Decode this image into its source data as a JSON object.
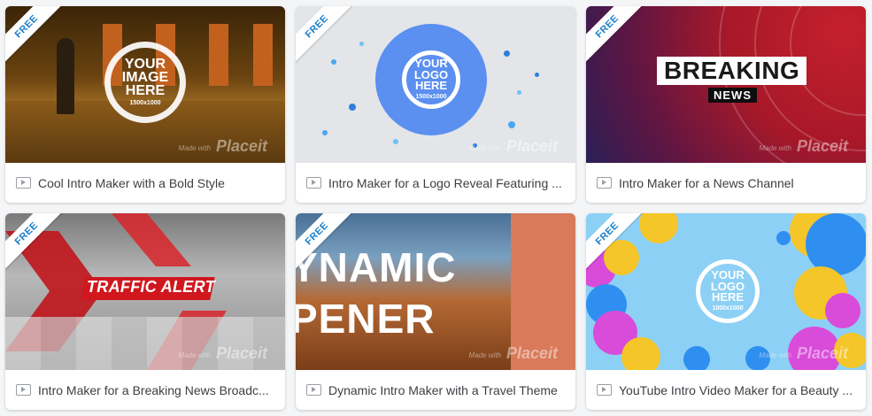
{
  "badge_label": "FREE",
  "watermark": {
    "small": "Made with",
    "brand": "Placeit"
  },
  "cards": [
    {
      "title": "Cool Intro Maker with a Bold Style",
      "overlay": {
        "line1": "YOUR",
        "line2": "IMAGE",
        "line3": "HERE",
        "dim": "1500x1000"
      }
    },
    {
      "title": "Intro Maker for a Logo Reveal Featuring ...",
      "overlay": {
        "line1": "YOUR",
        "line2": "LOGO",
        "line3": "HERE",
        "dim": "1500x1000"
      }
    },
    {
      "title": "Intro Maker for a News Channel",
      "overlay": {
        "line1": "BREAKING",
        "line2": "NEWS"
      }
    },
    {
      "title": "Intro Maker for a Breaking News Broadc...",
      "overlay": {
        "line1": "TRAFFIC ALERT"
      }
    },
    {
      "title": "Dynamic Intro Maker with a Travel Theme",
      "overlay": {
        "line1": "YNAMIC",
        "line2": "PENER"
      }
    },
    {
      "title": "YouTube Intro Video Maker for a Beauty ...",
      "overlay": {
        "line1": "YOUR",
        "line2": "LOGO",
        "line3": "HERE",
        "dim": "1000x1000"
      }
    }
  ],
  "colors": {
    "badge_text": "#1a7fc7",
    "card_bg": "#ffffff",
    "page_bg": "#f4f5f6",
    "title_text": "#3b3f44"
  }
}
